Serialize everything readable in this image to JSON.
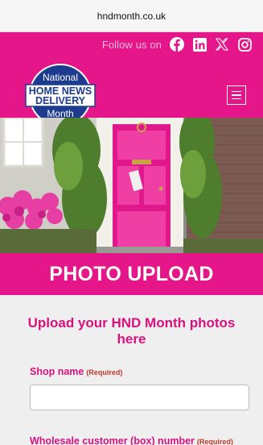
{
  "browser": {
    "url": "hndmonth.co.uk"
  },
  "header": {
    "follow_label": "Follow us on",
    "social_icons": [
      "facebook-icon",
      "linkedin-icon",
      "x-icon",
      "instagram-icon"
    ],
    "brand_color": "#e5158a"
  },
  "logo": {
    "line1": "National",
    "line2": "HOME NEWS",
    "line3": "DELIVERY",
    "line4": "Month"
  },
  "banner": {
    "title": "PHOTO UPLOAD"
  },
  "form": {
    "title": "Upload your HND Month photos here",
    "fields": [
      {
        "label": "Shop name",
        "required": "(Required)",
        "value": ""
      },
      {
        "label": "Wholesale customer (box) number",
        "required": "(Required)"
      }
    ]
  }
}
